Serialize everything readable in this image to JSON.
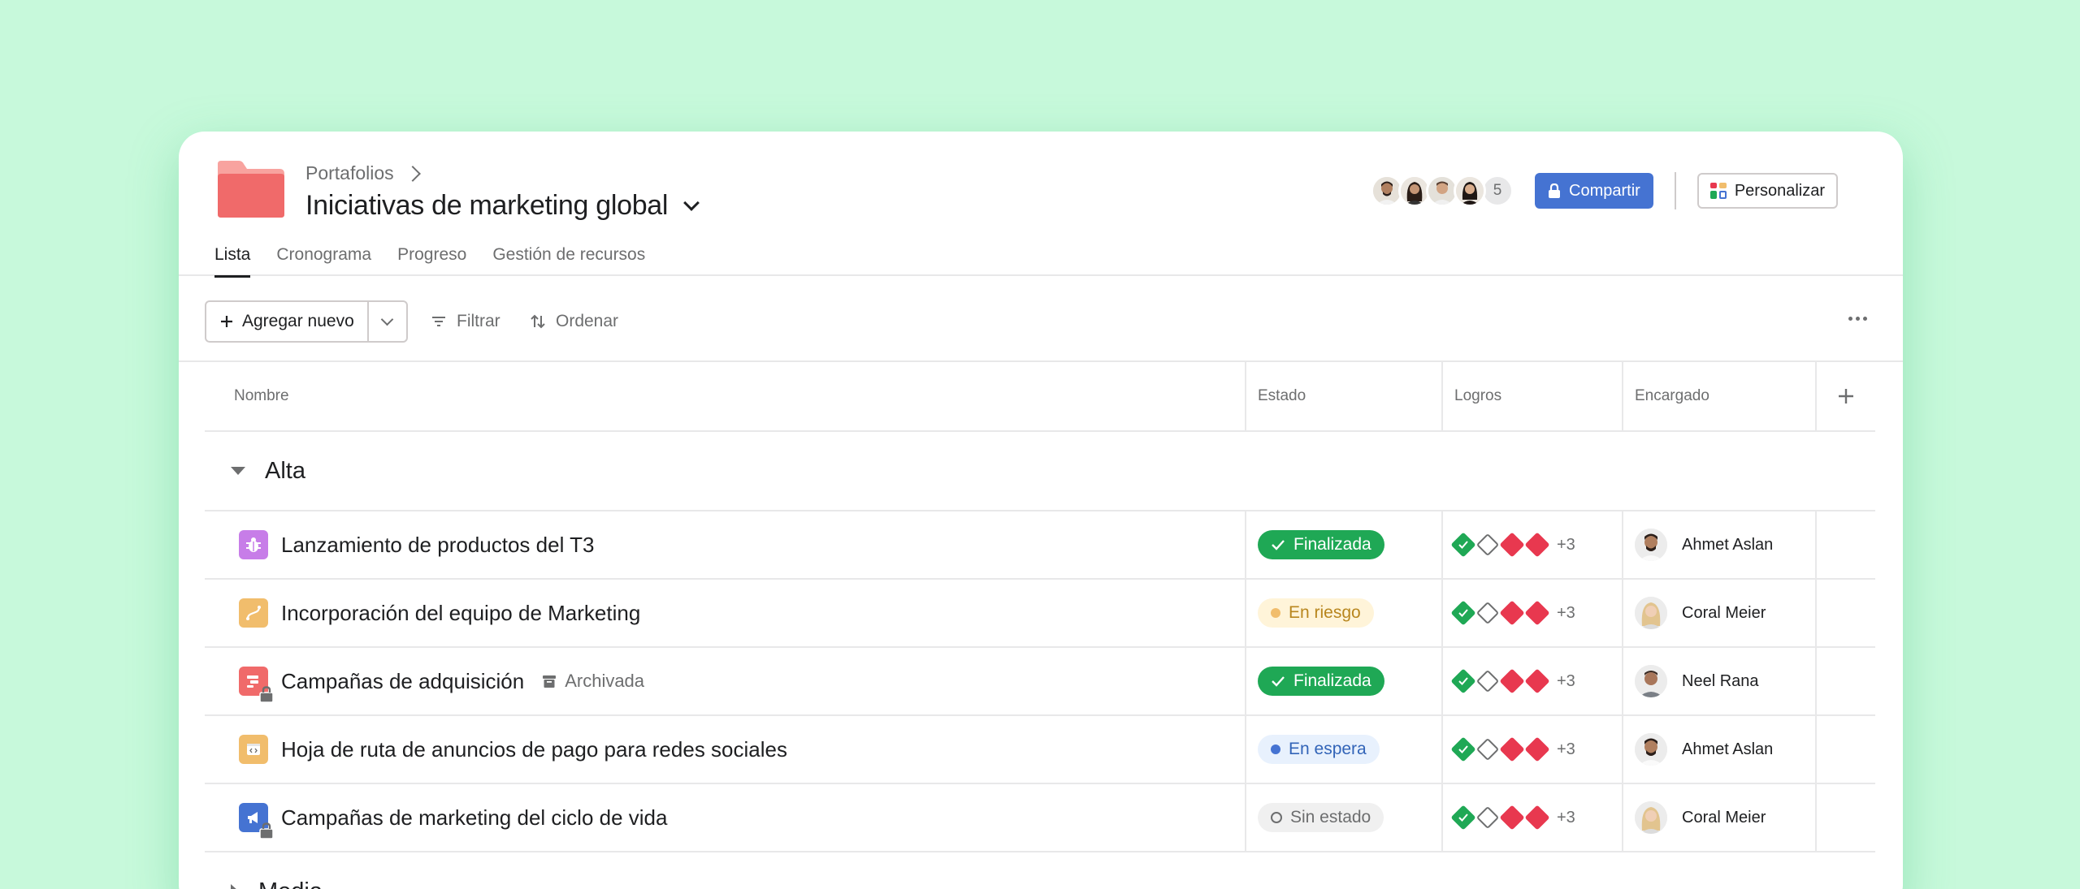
{
  "header": {
    "breadcrumb": "Portafolios",
    "title": "Iniciativas de marketing global",
    "avatar_count": "5",
    "share_label": "Compartir",
    "customize_label": "Personalizar"
  },
  "tabs": [
    {
      "label": "Lista",
      "active": true
    },
    {
      "label": "Cronograma",
      "active": false
    },
    {
      "label": "Progreso",
      "active": false
    },
    {
      "label": "Gestión de recursos",
      "active": false
    }
  ],
  "toolbar": {
    "add_label": "Agregar nuevo",
    "filter_label": "Filtrar",
    "sort_label": "Ordenar"
  },
  "columns": {
    "name": "Nombre",
    "state": "Estado",
    "goals": "Logros",
    "owner": "Encargado"
  },
  "sections": [
    {
      "title": "Alta"
    },
    {
      "title": "Media"
    }
  ],
  "rows": [
    {
      "name": "Lanzamiento de productos del T3",
      "status": "Finalizada",
      "goals_more": "+3",
      "owner": "Ahmet Aslan"
    },
    {
      "name": "Incorporación del equipo de Marketing",
      "status": "En riesgo",
      "goals_more": "+3",
      "owner": "Coral Meier"
    },
    {
      "name": "Campañas de adquisición",
      "archived": "Archivada",
      "status": "Finalizada",
      "goals_more": "+3",
      "owner": "Neel Rana"
    },
    {
      "name": "Hoja de ruta de anuncios de pago para redes sociales",
      "status": "En espera",
      "goals_more": "+3",
      "owner": "Ahmet Aslan"
    },
    {
      "name": "Campañas de marketing del ciclo de vida",
      "status": "Sin estado",
      "goals_more": "+3",
      "owner": "Coral Meier"
    }
  ],
  "colors": {
    "background": "#c7f9db",
    "primary": "#4573d2",
    "done": "#1fa855",
    "risk": "#f1bd6c",
    "hold": "#4573d2",
    "goal_red": "#e8384f",
    "folder": "#f06a6a"
  },
  "icons": {
    "folder": "folder-icon",
    "lock": "lock-icon",
    "plus": "plus-icon",
    "filter": "filter-icon",
    "sort": "sort-icon",
    "more": "more-icon",
    "archive": "archive-icon"
  }
}
